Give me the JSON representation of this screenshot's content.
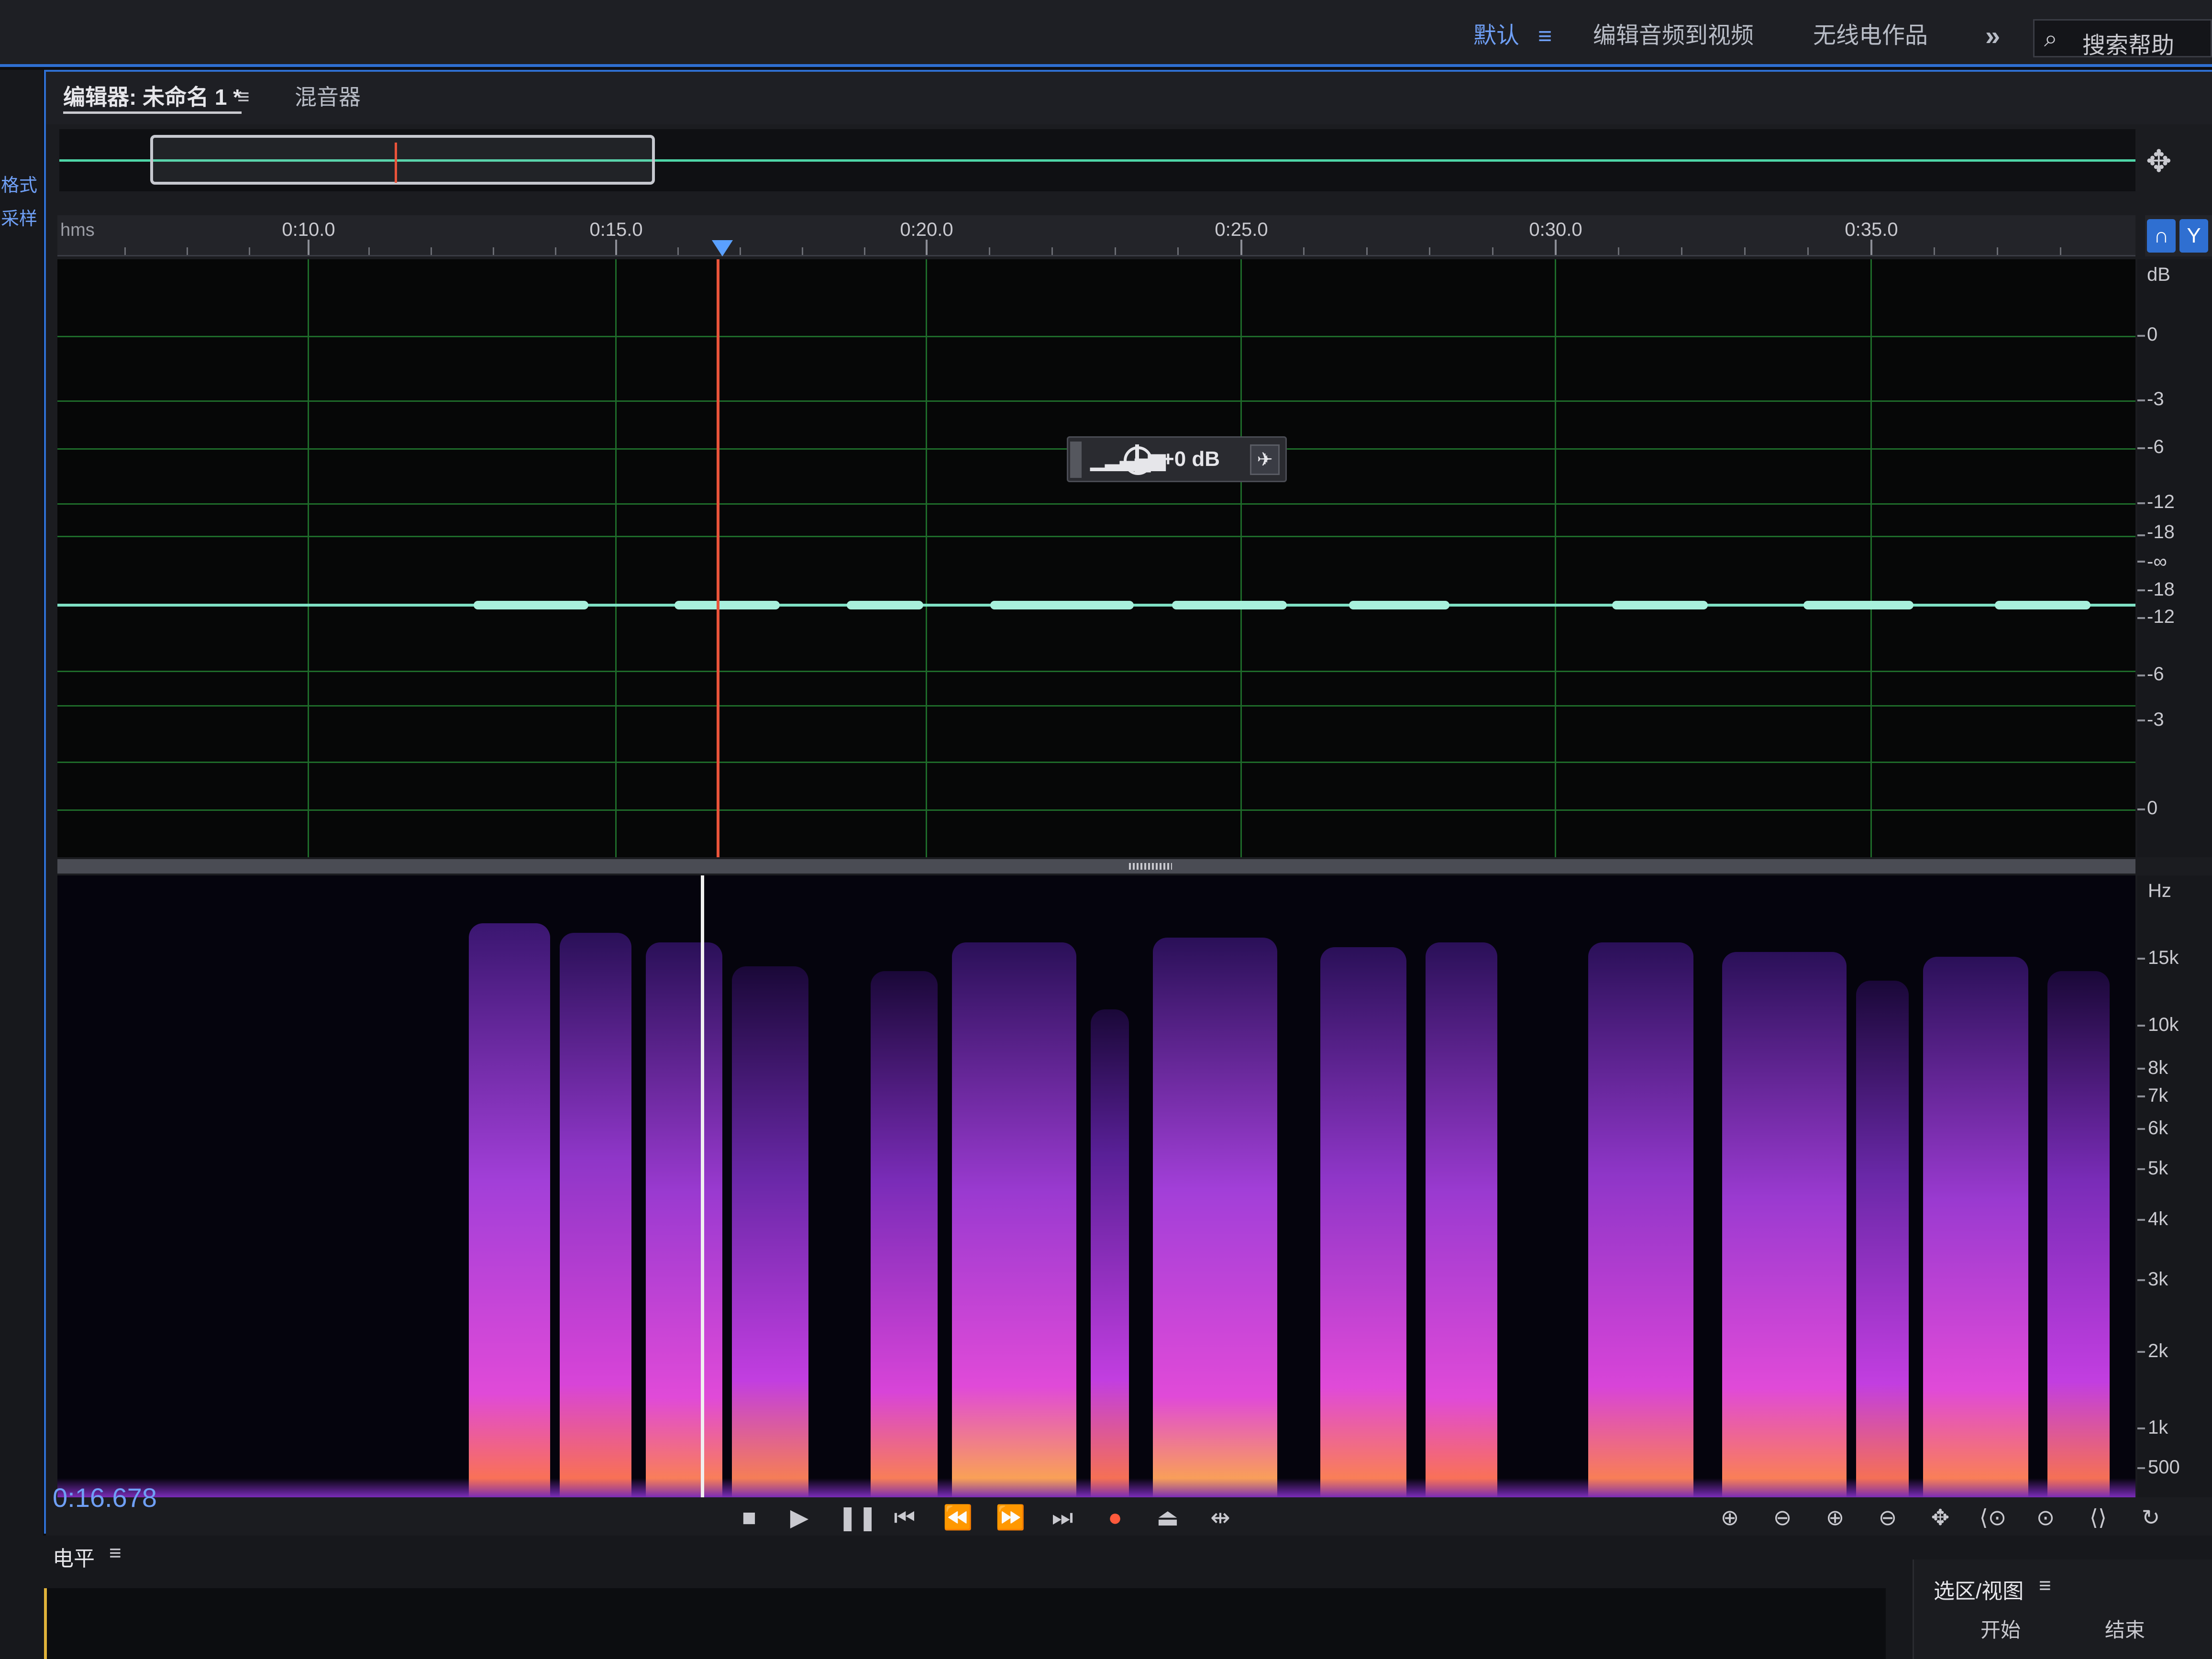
{
  "workspace": {
    "default_label": "默认",
    "menu_glyph": "≡",
    "edit_audio_video": "编辑音频到视频",
    "radio_works": "无线电作品",
    "more_glyph": "»",
    "search_label": "搜索帮助"
  },
  "left_strip": {
    "label_1": "格式",
    "label_2": "采样"
  },
  "editor": {
    "tab_editor": "编辑器: 未命名 1 *",
    "tab_menu_glyph": "≡",
    "tab_mixer": "混音器"
  },
  "ruler": {
    "unit": "hms",
    "labels": [
      "0:10.0",
      "0:15.0",
      "0:20.0",
      "0:25.0",
      "0:30.0",
      "0:35.0"
    ]
  },
  "hud": {
    "value": "+0 dB"
  },
  "db_scale": {
    "unit": "dB",
    "labels": [
      "0",
      "-3",
      "-6",
      "-12",
      "-18",
      "-∞",
      "-18",
      "-12",
      "-6",
      "-3",
      "0"
    ]
  },
  "hz_scale": {
    "unit": "Hz",
    "labels": [
      "15k",
      "10k",
      "8k",
      "7k",
      "6k",
      "5k",
      "4k",
      "3k",
      "2k",
      "1k",
      "500"
    ]
  },
  "transport": {
    "current_time": "0:16.678"
  },
  "level_panel": {
    "title": "电平",
    "menu_glyph": "≡"
  },
  "selection_panel": {
    "title": "选区/视图",
    "menu_glyph": "≡",
    "col_start": "开始",
    "col_end": "结束"
  },
  "colors": {
    "accent": "#2f6fd1",
    "waveform": "#7fe0c4",
    "grid": "#1e6b2a",
    "playhead": "#e8533a",
    "spectrogram_low": "#3a1670",
    "spectrogram_mid": "#c23ee0",
    "spectrogram_high": "#ff8a3c"
  },
  "icons": {
    "search": "search-icon",
    "zoom_nav": "zoom-navigate-icon",
    "power": "power-icon",
    "pin": "pin-icon"
  }
}
